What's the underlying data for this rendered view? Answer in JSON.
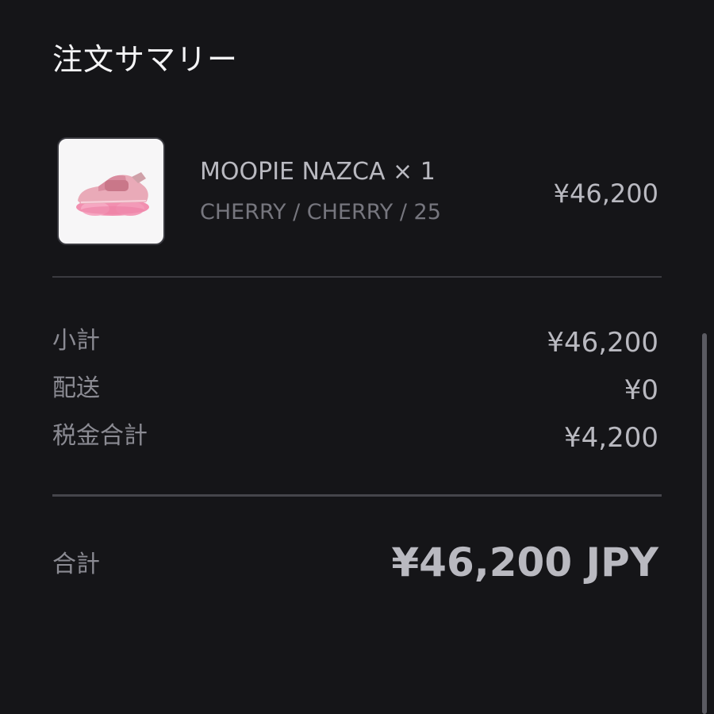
{
  "header": {
    "title": "注文サマリー"
  },
  "line_item": {
    "thumbnail_icon": "pink-sneaker-product-image",
    "name": "MOOPIE NAZCA × 1",
    "variant": "CHERRY / CHERRY / 25",
    "price": "¥46,200"
  },
  "summary": {
    "subtotal_label": "小計",
    "subtotal_value": "¥46,200",
    "shipping_label": "配送",
    "shipping_value": "¥0",
    "tax_label": "税金合計",
    "tax_value": "¥4,200"
  },
  "total": {
    "label": "合計",
    "value": "¥46,200 JPY"
  },
  "colors": {
    "background": "#151518",
    "divider": "#3a3a40",
    "text_primary": "#f4f4f6",
    "text_value": "#b9b9c0",
    "text_muted": "#8b8b93",
    "product_pink": "#f0a3b8"
  }
}
